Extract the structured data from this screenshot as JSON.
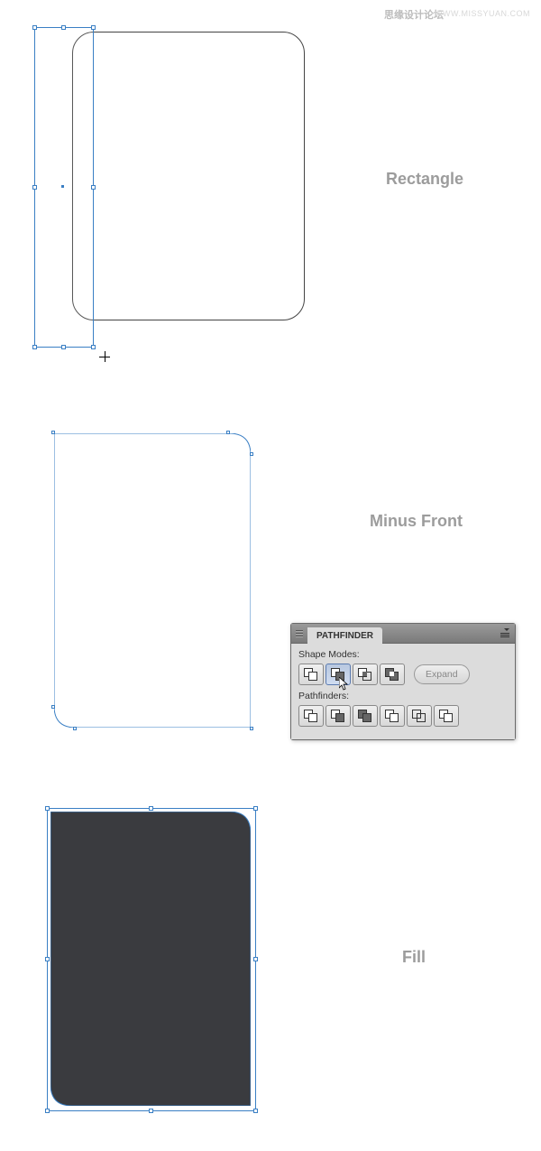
{
  "watermark": {
    "cn": "思缘设计论坛",
    "en": "WWW.MISSYUAN.COM"
  },
  "labels": {
    "step1": "Rectangle",
    "step2": "Minus Front",
    "step3": "Fill"
  },
  "panel": {
    "title": "PATHFINDER",
    "shape_modes_label": "Shape Modes:",
    "pathfinders_label": "Pathfinders:",
    "expand_label": "Expand",
    "shape_mode_buttons": [
      "unite",
      "minus-front",
      "intersect",
      "exclude"
    ],
    "pathfinder_buttons": [
      "divide",
      "trim",
      "merge",
      "crop",
      "outline",
      "minus-back"
    ],
    "active_button": "minus-front"
  },
  "fill_color": "#3a3b3f"
}
